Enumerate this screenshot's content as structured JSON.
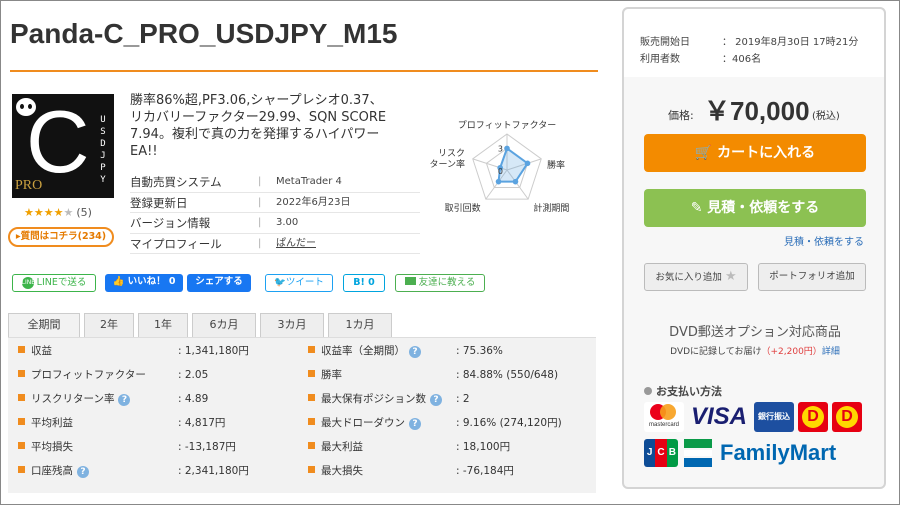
{
  "product": {
    "title": "Panda-C_PRO_USDJPY_M15",
    "description": "勝率86%超,PF3.06,シャープレシオ0.37、リカバリーファクター29.99、SQN SCORE 7.94。複利で真の力を発揮するハイパワーEA!!",
    "logo": {
      "letter": "C",
      "side_text": "USDJPY",
      "badge": "PRO"
    },
    "rating": {
      "filled": 4,
      "total": 5,
      "count_label": "(5)"
    },
    "reviews_link": "▸質問はコチラ(234)"
  },
  "info": [
    {
      "key": "自動売買システム",
      "value": "MetaTrader 4"
    },
    {
      "key": "登録更新日",
      "value": "2022年6月23日"
    },
    {
      "key": "バージョン情報",
      "value": "3.00"
    },
    {
      "key": "マイプロフィール",
      "value": "ぱんだー"
    }
  ],
  "radar": {
    "labels": [
      "プロフィットファクター",
      "勝率",
      "計測期間",
      "取引回数",
      "リスク\nターン率"
    ],
    "values": [
      3,
      3,
      2,
      2,
      1
    ],
    "scale_min": 0,
    "scale_max": 5,
    "center_label": "0",
    "tick_label": "3",
    "color": "#5ba3e0"
  },
  "social": {
    "line": "LINEで送る",
    "like": "いいね！ 0",
    "share": "シェアする",
    "tweet": "ツイート",
    "hatena": "B! 0",
    "friend": "友達に教える"
  },
  "tabs": [
    "全期間",
    "2年",
    "1年",
    "6カ月",
    "3カ月",
    "1カ月"
  ],
  "stats_left": [
    {
      "label": "収益",
      "value": ": 1,341,180円",
      "help": false
    },
    {
      "label": "プロフィットファクター",
      "value": ": 2.05",
      "help": false
    },
    {
      "label": "リスクリターン率",
      "value": ": 4.89",
      "help": true
    },
    {
      "label": "平均利益",
      "value": ": 4,817円",
      "help": false
    },
    {
      "label": "平均損失",
      "value": ": -13,187円",
      "help": false
    },
    {
      "label": "口座残高",
      "value": ": 2,341,180円",
      "help": true
    }
  ],
  "stats_right": [
    {
      "label": "収益率（全期間）",
      "value": ": 75.36%",
      "help": true
    },
    {
      "label": "勝率",
      "value": ": 84.88% (550/648)",
      "help": false
    },
    {
      "label": "最大保有ポジション数",
      "value": ": 2",
      "help": true
    },
    {
      "label": "最大ドローダウン",
      "value": ": 9.16% (274,120円)",
      "help": true
    },
    {
      "label": "最大利益",
      "value": ": 18,100円",
      "help": false
    },
    {
      "label": "最大損失",
      "value": ": -76,184円",
      "help": false
    }
  ],
  "sidebar": {
    "sale_start_label": "販売開始日",
    "sale_start_value": "： 2019年8月30日 17時21分",
    "users_label": "利用者数",
    "users_value": "：406名",
    "price_label": "価格:",
    "price": "￥70,000",
    "price_tax": "(税込)",
    "cart_button": "カートに入れる",
    "quote_button": "見積・依頼をする",
    "quote_link": "見積・依頼をする",
    "favorite_button": "お気に入り追加",
    "portfolio_button": "ポートフォリオ追加",
    "dvd_title": "DVD郵送オプション対応商品",
    "dvd_sub_a": "DVDに記録してお届け",
    "dvd_sub_price": "（+2,200円）",
    "dvd_sub_link": "詳細",
    "payment_title": "お支払い方法",
    "payments": {
      "mastercard": "mastercard",
      "visa": "VISA",
      "bank": "銀行振込",
      "jcb": "JCB",
      "familymart": "FamilyMart"
    }
  },
  "colors": {
    "accent": "#f08c1e",
    "cart": "#f38b00",
    "quote": "#8cc152",
    "link": "#2a6db8"
  }
}
